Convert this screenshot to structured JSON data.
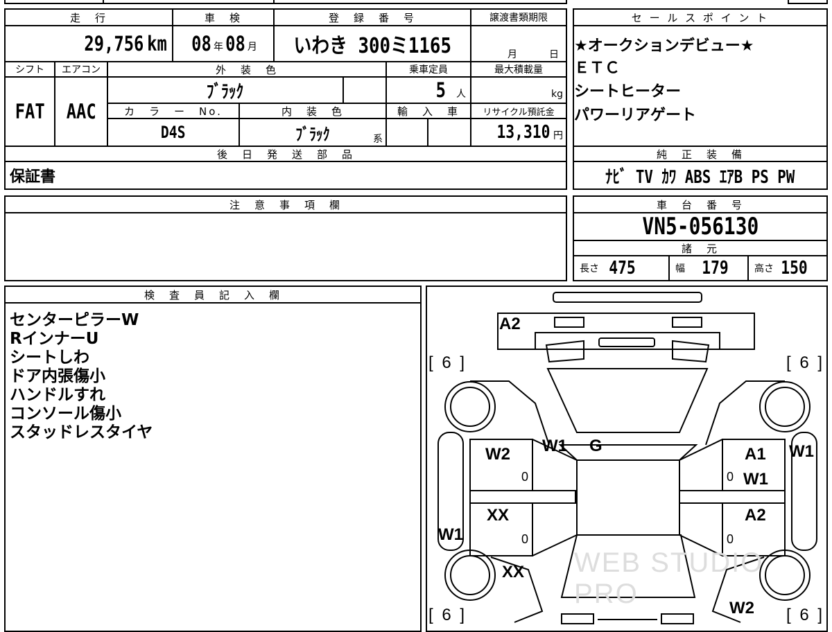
{
  "vehicle": {
    "mileage_label": "走　行",
    "mileage_value": "29,756",
    "mileage_unit": "km",
    "inspection_label": "車　検",
    "inspection_year": "08",
    "inspection_year_unit": "年",
    "inspection_month": "08",
    "inspection_month_unit": "月",
    "registration_label": "登　録　番　号",
    "registration_value": "いわき 300ミ1165",
    "transfer_deadline_label": "譲渡書類期限",
    "transfer_month_unit": "月",
    "transfer_day_unit": "日",
    "shift_label": "シフト",
    "shift_value": "FAT",
    "aircon_label": "エアコン",
    "aircon_value": "AAC",
    "exterior_color_label": "外　装　色",
    "exterior_color_value": "ﾌﾞﾗｯｸ",
    "capacity_label": "乗車定員",
    "capacity_value": "5",
    "capacity_unit": "人",
    "max_load_label": "最大積載量",
    "max_load_unit": "kg",
    "color_no_label": "カ　ラ　ー　No.",
    "color_no_value": "D4S",
    "interior_color_label": "内　装　色",
    "interior_color_value": "ﾌﾞﾗｯｸ",
    "interior_color_suffix": "系",
    "import_label": "輸　入　車",
    "recycle_label": "リサイクル預託金",
    "recycle_value": "13,310",
    "recycle_unit": "円",
    "later_parts_label": "後　日　発　送　部　品",
    "later_parts_value": "保証書"
  },
  "sales_points": {
    "title": "セ ー ル ス ポ イ ン ト",
    "items": [
      "★オークションデビュー★",
      "ＥＴＣ",
      "シートヒーター",
      "パワーリアゲート"
    ]
  },
  "equipment": {
    "title": "純　正　装　備",
    "value": "ﾅﾋﾞ TV ｶﾜ ABS ｴｱB PS PW"
  },
  "notes": {
    "title": "注　意　事　項　欄"
  },
  "chassis": {
    "title": "車　台　番　号",
    "value": "VN5-056130",
    "spec_title": "諸　元",
    "length_label": "長さ",
    "length_value": "475",
    "width_label": "幅",
    "width_value": "179",
    "height_label": "高さ",
    "height_value": "150"
  },
  "inspector": {
    "title": "検　査　員　記　入　欄",
    "lines": [
      "センターピラーW",
      "RインナーU",
      "シートしわ",
      "ドア内張傷小",
      "ハンドルすれ",
      "コンソール傷小",
      "スタッドレスタイヤ"
    ]
  },
  "diagram": {
    "tire_fl": "[ 6 ]",
    "tire_fr": "[ 6 ]",
    "tire_rl": "[ 6 ]",
    "tire_rr": "[ 6 ]",
    "marks": {
      "a2_front": "A2",
      "w1_top": "W1",
      "g": "G",
      "w2_left": "W2",
      "a1_right": "A1",
      "w1_right_top": "W1",
      "w1_right_inner": "W1",
      "xx_left": "XX",
      "a2_right": "A2",
      "w1_left": "W1",
      "xx_rear": "XX",
      "w2_rear": "W2"
    },
    "zeros": [
      "0",
      "0",
      "0",
      "0"
    ],
    "watermark": "WEB STUDIO PRO"
  }
}
